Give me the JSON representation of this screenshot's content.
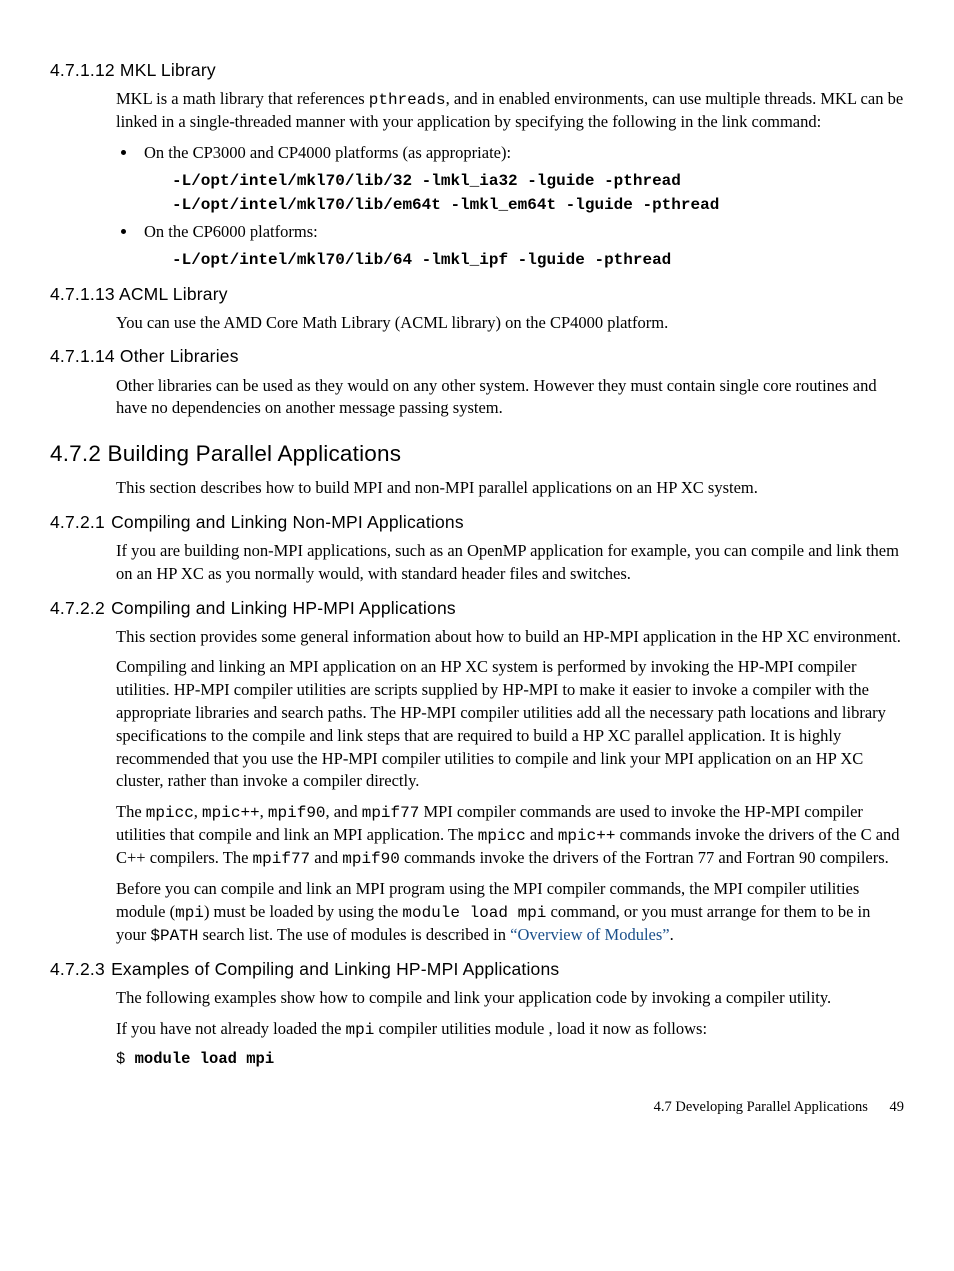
{
  "s1": {
    "num": "4.7.1.12",
    "title": "MKL Library",
    "p1a": "MKL is a math library that references ",
    "p1code": "pthreads",
    "p1b": ", and in enabled environments, can use multiple threads. MKL can be linked in a single-threaded manner with your application by specifying the following in the link command:",
    "b1": "On the CP3000 and CP4000 platforms (as appropriate):",
    "c1": "-L/opt/intel/mkl70/lib/32 -lmkl_ia32 -lguide -pthread",
    "c2": "-L/opt/intel/mkl70/lib/em64t -lmkl_em64t -lguide -pthread",
    "b2": "On the CP6000 platforms:",
    "c3": "-L/opt/intel/mkl70/lib/64 -lmkl_ipf -lguide -pthread"
  },
  "s2": {
    "num": "4.7.1.13",
    "title": "ACML Library",
    "p1": "You can use the AMD Core Math Library (ACML library) on the CP4000 platform."
  },
  "s3": {
    "num": "4.7.1.14",
    "title": "Other Libraries",
    "p1": "Other libraries can be used as they would on any other system. However they must contain single core routines and have no dependencies on another message passing system."
  },
  "s4": {
    "num": "4.7.2",
    "title": "Building Parallel Applications",
    "p1": "This section describes how to build MPI and non-MPI parallel applications on an HP XC system."
  },
  "s5": {
    "num": "4.7.2.1",
    "title": "Compiling and Linking Non-MPI Applications",
    "p1": "If you are building non-MPI applications, such as an OpenMP application for example, you can compile and link them on an HP XC as you normally would, with standard header files and switches."
  },
  "s6": {
    "num": "4.7.2.2",
    "title": "Compiling and Linking HP-MPI Applications",
    "p1": "This section provides some general information about how to build an HP-MPI application in the HP XC environment.",
    "p2": "Compiling and linking an MPI application on an HP XC system is performed by invoking the HP-MPI compiler utilities. HP-MPI compiler utilities are scripts supplied by HP-MPI to make it easier to invoke a compiler with the appropriate libraries and search paths. The HP-MPI compiler utilities add all the necessary path locations and library specifications to the compile and link steps that are required to build a HP XC parallel application. It is highly recommended that you use the HP-MPI compiler utilities to compile and link your MPI application on an HP XC cluster, rather than invoke a compiler directly.",
    "p3a": "The ",
    "p3c1": "mpicc",
    "p3s1": ", ",
    "p3c2": "mpic++",
    "p3s2": ", ",
    "p3c3": "mpif90",
    "p3s3": ", and ",
    "p3c4": "mpif77",
    "p3b": " MPI compiler commands are used to invoke the HP-MPI compiler utilities that compile and link an MPI application. The ",
    "p3c5": "mpicc",
    "p3s4": " and ",
    "p3c6": "mpic++",
    "p3d": " commands invoke the drivers of the C and C++ compilers. The ",
    "p3c7": "mpif77",
    "p3s5": " and ",
    "p3c8": "mpif90",
    "p3e": " commands invoke the drivers of the Fortran 77 and Fortran 90 compilers.",
    "p4a": "Before you can compile and link an MPI program using the MPI compiler commands, the MPI compiler utilities module (",
    "p4c1": "mpi",
    "p4b": ") must be loaded by using the ",
    "p4c2": "module load mpi",
    "p4c": " command, or you must arrange for them to be in your ",
    "p4c3": "$PATH",
    "p4d": " search list. The use of modules is described in ",
    "p4link": "“Overview of Modules”",
    "p4e": "."
  },
  "s7": {
    "num": "4.7.2.3",
    "title": "Examples of Compiling and Linking HP-MPI Applications",
    "p1": "The following examples show how to compile and link your application code by invoking a compiler utility.",
    "p2a": "If you have not already loaded the ",
    "p2c1": "mpi",
    "p2b": " compiler utilities module , load it now as follows:",
    "prompt": "$ ",
    "cmd": "module load mpi"
  },
  "footer": {
    "section": "4.7 Developing Parallel Applications",
    "page": "49"
  }
}
